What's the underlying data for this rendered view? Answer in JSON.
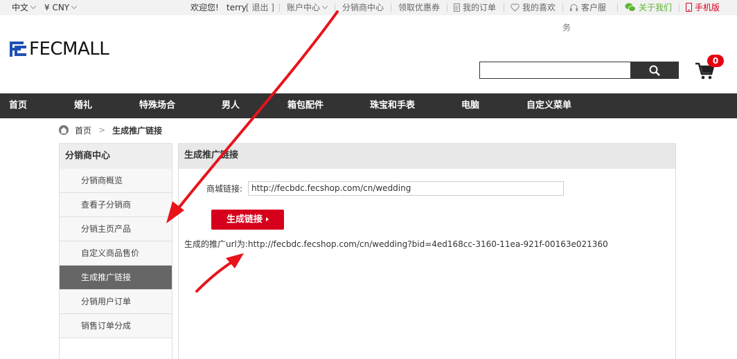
{
  "topbar": {
    "language": "中文",
    "currency": "¥ CNY",
    "welcome": "欢迎您!",
    "username": "terry",
    "logout": "[ 退出 ]",
    "account_center": "账户中心",
    "distributor_center": "分销商中心",
    "coupons": "领取优惠券",
    "my_orders": "我的订单",
    "my_favorites": "我的喜欢",
    "customer_service": "客户服",
    "customer_service_wrap": "务",
    "about_us": "关于我们",
    "mobile": "手机版"
  },
  "header": {
    "logo_text": "FECMALL",
    "search_value": "",
    "cart_count": "0"
  },
  "nav": [
    "首页",
    "婚礼",
    "特殊场合",
    "男人",
    "箱包配件",
    "珠宝和手表",
    "电脑",
    "自定义菜单"
  ],
  "breadcrumb": {
    "home": "首页",
    "separator": ">",
    "current": "生成推广链接"
  },
  "sidebar": {
    "title": "分销商中心",
    "items": [
      "分销商概览",
      "查看子分销商",
      "分销主页产品",
      "自定义商品售价",
      "生成推广链接",
      "分销用户订单",
      "销售订单分成"
    ],
    "active_index": 4
  },
  "main": {
    "title": "生成推广链接",
    "mall_link_label": "商城链接:",
    "mall_link_value": "http://fecbdc.fecshop.com/cn/wedding",
    "generate_button": "生成链接",
    "result_label": "生成的推广url为:",
    "result_url": "http://fecbdc.fecshop.com/cn/wedding?bid=4ed168cc-3160-11ea-921f-00163e021360"
  },
  "colors": {
    "accent_red": "#d6001c",
    "nav_bg": "#333333",
    "annotation_arrow": "#e8131b"
  }
}
